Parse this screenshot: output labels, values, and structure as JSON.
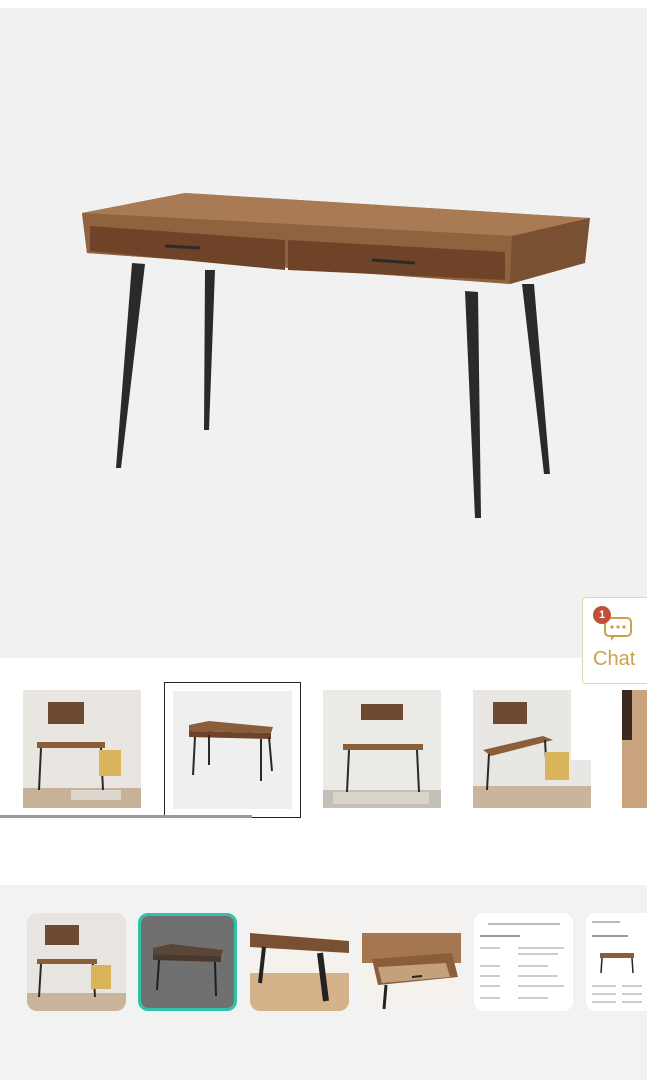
{
  "chat": {
    "badge": "1",
    "label": "Chat",
    "accent": "#c9a24a",
    "badge_color": "#c0503a"
  },
  "thumbnails": [
    {
      "name": "room-scene-1",
      "selected": false
    },
    {
      "name": "desk-studio",
      "selected": true
    },
    {
      "name": "room-scene-2",
      "selected": false
    },
    {
      "name": "room-scene-3",
      "selected": false
    },
    {
      "name": "partial-5",
      "selected": false
    }
  ],
  "gallery": [
    {
      "name": "room-scene",
      "active": false
    },
    {
      "name": "desk-dark",
      "active": true
    },
    {
      "name": "leg-detail",
      "active": false
    },
    {
      "name": "drawer-open",
      "active": false
    },
    {
      "name": "spec-sheet",
      "active": false
    },
    {
      "name": "dimensions-sheet",
      "active": false
    }
  ],
  "accent_selected": "#2fc2a8"
}
